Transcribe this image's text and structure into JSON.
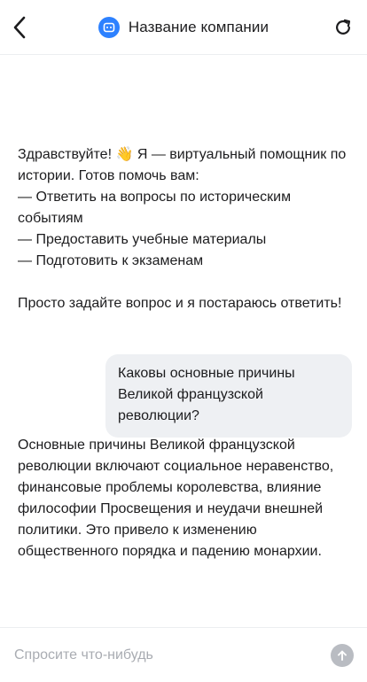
{
  "header": {
    "title": "Название компании",
    "back_icon": "chevron-left-icon",
    "logo_icon": "bot-face-icon",
    "refresh_icon": "refresh-icon",
    "logo_color": "#2d81ff"
  },
  "messages": [
    {
      "role": "assistant",
      "text": "Здравствуйте! 👋 Я — виртуальный помощник по истории. Готов помочь вам:\n— Ответить на вопросы по историческим событиям\n— Предоставить учебные материалы\n— Подготовить к экзаменам\n\nПросто задайте вопрос и я постараюсь ответить!"
    },
    {
      "role": "user",
      "text": "Каковы основные причины Великой французской революции?"
    },
    {
      "role": "assistant",
      "text": "Основные причины Великой французской революции включают социальное неравенство, финансовые проблемы королевства, влияние философии Просвещения и неудачи внешней политики. Это привело к изменению общественного порядка и падению монархии."
    }
  ],
  "composer": {
    "placeholder": "Спросите что-нибудь",
    "value": "",
    "send_icon": "arrow-up-icon",
    "send_color": "#b9bcc2"
  }
}
